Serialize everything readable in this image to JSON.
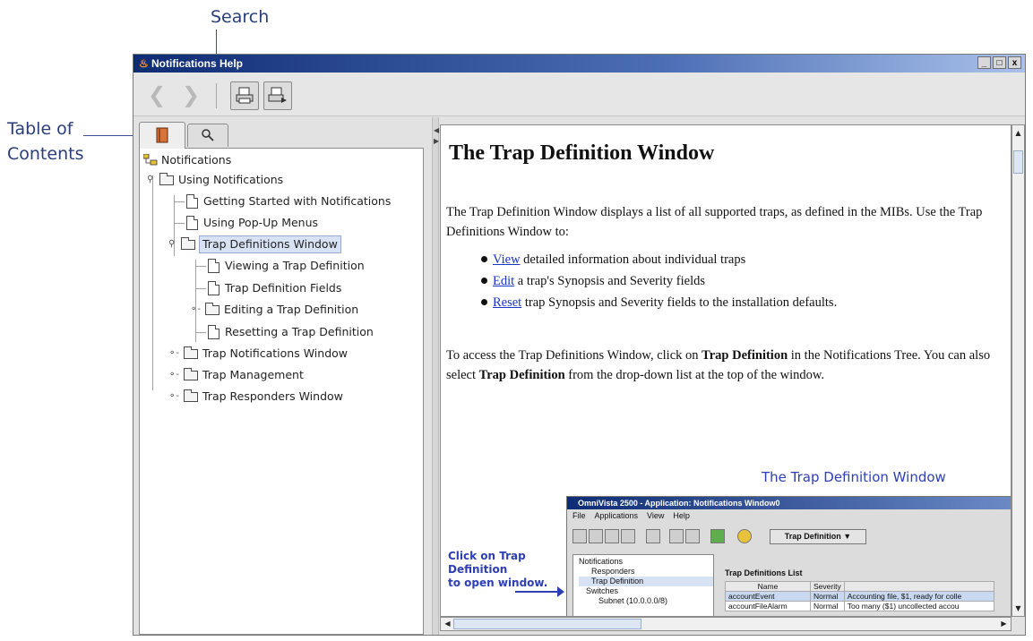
{
  "annotations": {
    "search": "Search",
    "toc_line1": "Table of",
    "toc_line2": "Contents"
  },
  "window": {
    "title": "Notifications Help",
    "controls": [
      "_",
      "□",
      "x"
    ]
  },
  "toolbar": {
    "back_icon": "chevron-left-icon",
    "forward_icon": "chevron-right-icon",
    "print_icon": "printer-icon",
    "print_setup_icon": "print-setup-icon"
  },
  "tabs": {
    "toc_icon": "book-icon",
    "search_icon": "magnifier-icon"
  },
  "tree": {
    "root": "Notifications",
    "items": [
      "Using Notifications",
      "Getting Started with Notifications",
      "Using Pop-Up Menus",
      "Trap Definitions Window",
      "Viewing a Trap Definition",
      "Trap Definition Fields",
      "Editing a Trap Definition",
      "Resetting a Trap Definition",
      "Trap Notifications Window",
      "Trap Management",
      "Trap Responders Window"
    ]
  },
  "content": {
    "heading": "The Trap Definition Window",
    "intro": "The Trap Definition Window displays a list of all supported traps, as defined in the MIBs. Use the Trap Definitions Window to:",
    "bullets": [
      {
        "link": "View",
        "text": " detailed information about individual traps"
      },
      {
        "link": "Edit",
        "text": " a trap's Synopsis and Severity fields"
      },
      {
        "link": "Reset",
        "text": " trap Synopsis and Severity fields to the installation defaults."
      }
    ],
    "access_p1": "To access the Trap Definitions Window, click on ",
    "access_b1": "Trap Definition",
    "access_p2": " in the Notifications Tree. You can also select ",
    "access_b2": "Trap Definition",
    "access_p3": " from the drop-down list at the top of the window.",
    "figure_caption": "The Trap Definition Window",
    "click_caption_1": "Click on Trap",
    "click_caption_2": "Definition",
    "click_caption_3": "to open window."
  },
  "mini": {
    "title": "OmniVista 2500 -  Application: Notifications  Window0",
    "menu": [
      "File",
      "Applications",
      "View",
      "Help"
    ],
    "dropdown": "Trap Definition ▼",
    "tree": [
      "Notifications",
      "Responders",
      "Trap Definition",
      "Switches",
      "Subnet (10.0.0.0/8)"
    ],
    "list_title": "Trap Definitions List",
    "columns": [
      "Name",
      "Severity",
      ""
    ],
    "rows": [
      [
        "accountEvent",
        "Normal",
        "Accounting file, $1, ready for colle"
      ],
      [
        "accountFileAlarm",
        "Normal",
        "Too many ($1) uncollected accou"
      ]
    ]
  }
}
